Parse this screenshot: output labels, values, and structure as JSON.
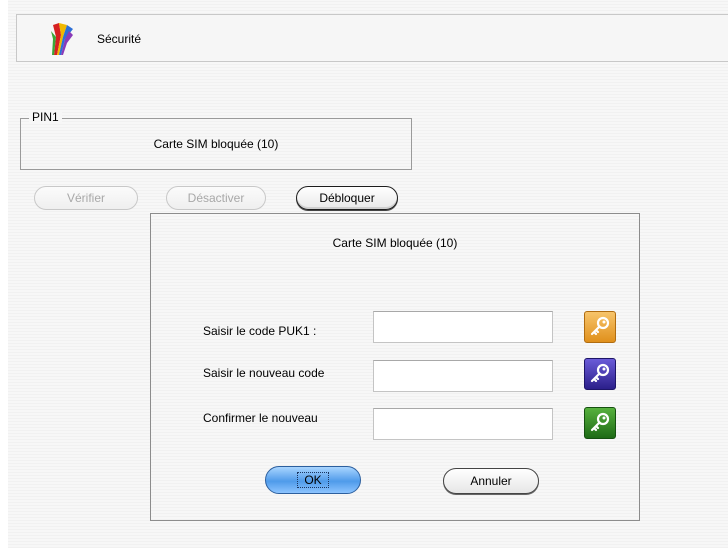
{
  "app": {
    "title": "Sécurité",
    "icon": "phone-tools-icon"
  },
  "pin_group": {
    "legend": "PIN1",
    "status": "Carte SIM bloquée (10)"
  },
  "actions": {
    "verify_label": "Vérifier",
    "disable_label": "Désactiver",
    "unblock_label": "Débloquer"
  },
  "dialog": {
    "title": "Carte SIM bloquée (10)",
    "fields": [
      {
        "label": "Saisir le code PUK1 :",
        "value": "",
        "key_icon": "key-icon",
        "key_color": "#e8a232"
      },
      {
        "label": "Saisir le nouveau code",
        "value": "",
        "key_icon": "key-icon",
        "key_color": "#3a2ca8"
      },
      {
        "label": "Confirmer le nouveau",
        "value": "",
        "key_icon": "key-icon",
        "key_color": "#2e8a22"
      }
    ],
    "ok_label": "OK",
    "cancel_label": "Annuler"
  }
}
